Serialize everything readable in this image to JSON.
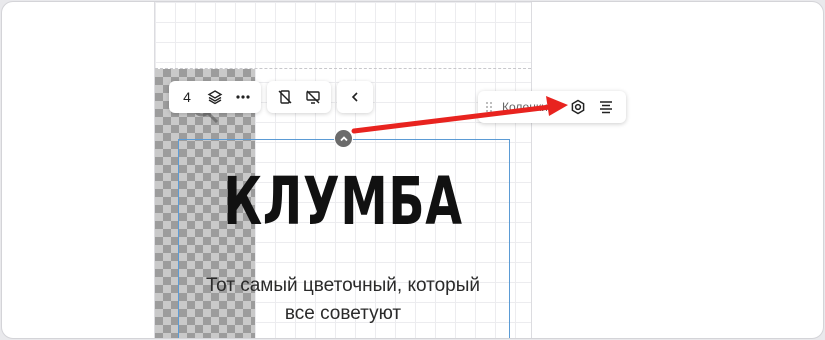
{
  "toolbar": {
    "count": "4",
    "icons": [
      "layers-icon",
      "more-icon",
      "hide-mobile-icon",
      "hide-desktop-icon",
      "chevron-left-icon"
    ]
  },
  "column_panel": {
    "label": "Колонки",
    "icons": [
      "gear-icon",
      "align-center-icon"
    ]
  },
  "block": {
    "title": "КЛУМБА",
    "subtitle_line1": "Тот самый цветочный, который",
    "subtitle_line2": "все советуют"
  },
  "colors": {
    "arrow": "#e8231f",
    "selection": "#5b9bd5"
  }
}
